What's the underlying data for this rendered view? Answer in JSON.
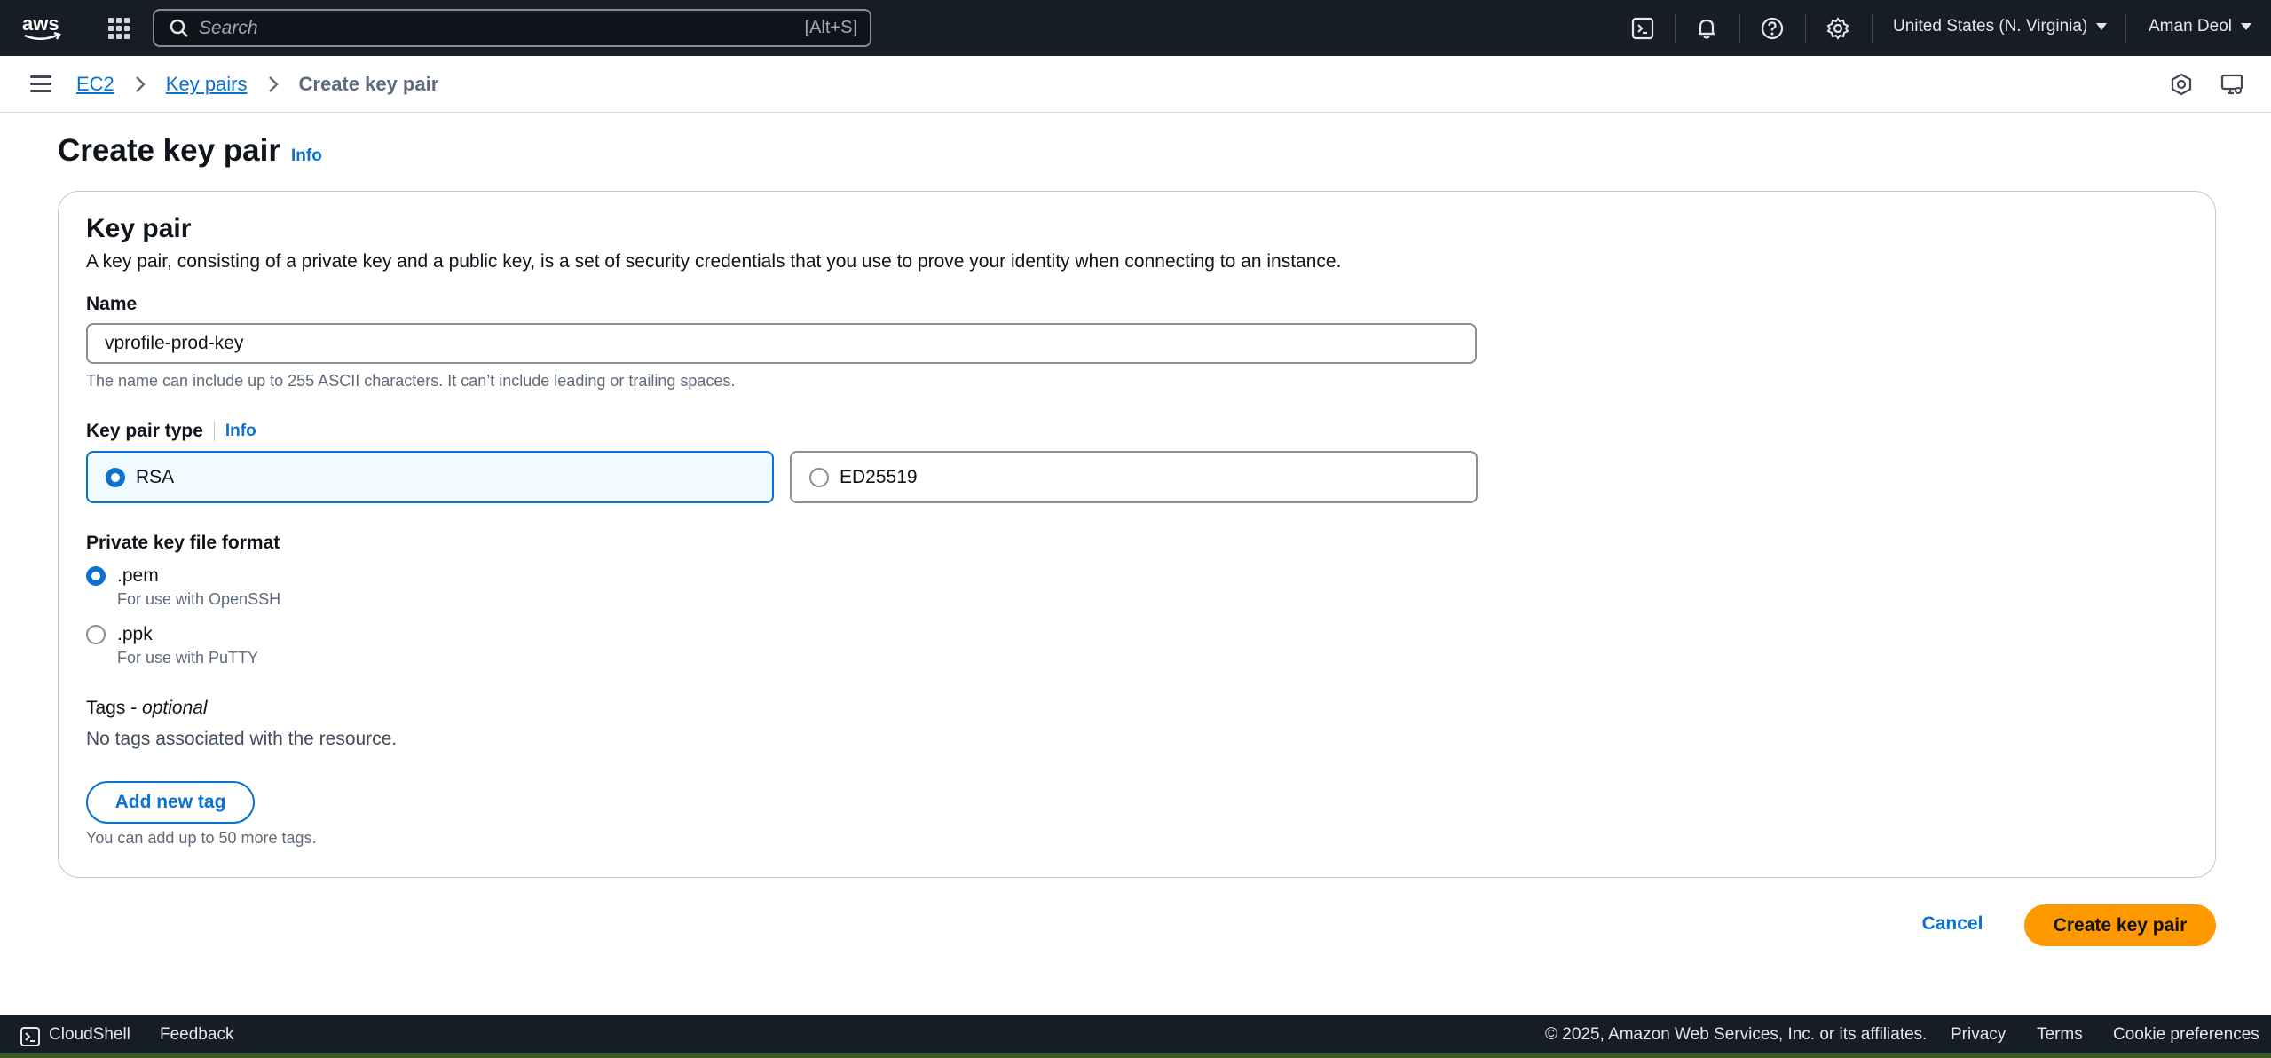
{
  "topnav": {
    "logo_text": "aws",
    "search_placeholder": "Search",
    "search_shortcut": "[Alt+S]",
    "region": "United States (N. Virginia)",
    "user": "Aman Deol"
  },
  "breadcrumb": {
    "items": [
      "EC2",
      "Key pairs"
    ],
    "current": "Create key pair"
  },
  "page": {
    "title": "Create key pair",
    "info": "Info"
  },
  "panel": {
    "title": "Key pair",
    "description": "A key pair, consisting of a private key and a public key, is a set of security credentials that you use to prove your identity when connecting to an instance.",
    "name_label": "Name",
    "name_value": "vprofile-prod-key",
    "name_hint": "The name can include up to 255 ASCII characters. It can’t include leading or trailing spaces.",
    "type_label": "Key pair type",
    "type_info": "Info",
    "type_options": [
      {
        "label": "RSA",
        "selected": true
      },
      {
        "label": "ED25519",
        "selected": false
      }
    ],
    "format_label": "Private key file format",
    "format_options": [
      {
        "label": ".pem",
        "desc": "For use with OpenSSH",
        "selected": true
      },
      {
        "label": ".ppk",
        "desc": "For use with PuTTY",
        "selected": false
      }
    ],
    "tags_label": "Tags - ",
    "tags_optional": "optional",
    "tags_empty": "No tags associated with the resource.",
    "add_tag": "Add new tag",
    "tags_hint": "You can add up to 50 more tags."
  },
  "actions": {
    "cancel": "Cancel",
    "create": "Create key pair"
  },
  "footer": {
    "cloudshell": "CloudShell",
    "feedback": "Feedback",
    "copyright": "© 2025, Amazon Web Services, Inc. or its affiliates.",
    "privacy": "Privacy",
    "terms": "Terms",
    "cookies": "Cookie preferences"
  },
  "colors": {
    "nav_bg": "#161d26",
    "link": "#0972d3",
    "primary_button": "#ff9900",
    "selected_tile_bg": "#f0fbff"
  }
}
